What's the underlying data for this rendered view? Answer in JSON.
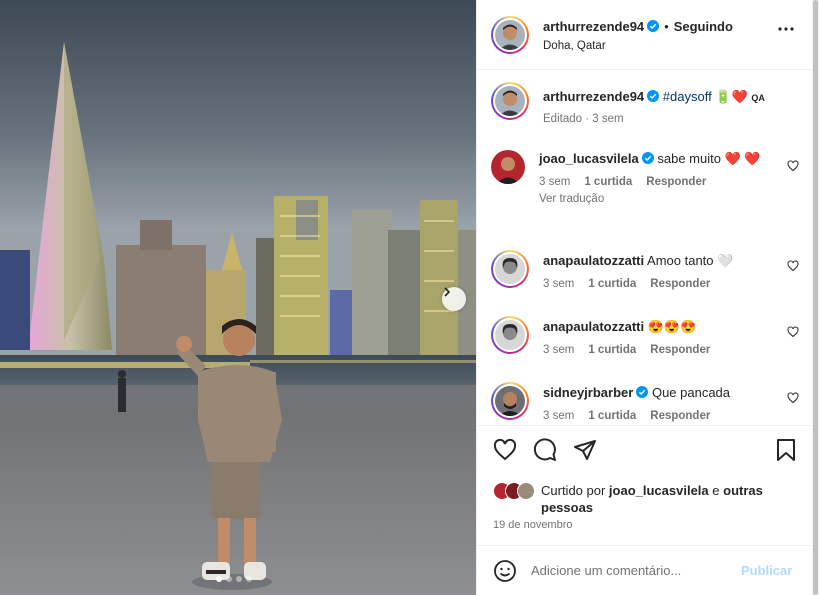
{
  "post": {
    "author": "arthurrezende94",
    "follow_sep": "•",
    "follow_status": "Seguindo",
    "location": "Doha, Qatar",
    "carousel_pages": 4,
    "carousel_active": 1
  },
  "caption": {
    "author": "arthurrezende94",
    "hashtag": "#daysoff",
    "emoji": "🔋❤️",
    "flag": "QA",
    "meta": "Editado · 3 sem"
  },
  "comments": [
    {
      "author": "joao_lucasvilela",
      "verified": true,
      "text": "sabe muito ❤️ ❤️",
      "time": "3 sem",
      "likes": "1 curtida",
      "reply": "Responder",
      "translate": "Ver tradução"
    },
    {
      "author": "anapaulatozzatti",
      "verified": false,
      "text": "Amoo tanto 🤍",
      "time": "3 sem",
      "likes": "1 curtida",
      "reply": "Responder"
    },
    {
      "author": "anapaulatozzatti",
      "verified": false,
      "text": "😍😍😍",
      "time": "3 sem",
      "likes": "1 curtida",
      "reply": "Responder"
    },
    {
      "author": "sidneyjrbarber",
      "verified": true,
      "text": "Que pancada",
      "time": "3 sem",
      "likes": "1 curtida",
      "reply": "Responder"
    }
  ],
  "likes": {
    "prefix": "Curtido por ",
    "user": "joao_lucasvilela",
    "middle": " e ",
    "others": "outras pessoas"
  },
  "date": "19 de novembro",
  "add_comment": {
    "placeholder": "Adicione um comentário...",
    "publish": "Publicar"
  },
  "colors": {
    "verified": "#0095f6",
    "link": "#00376b",
    "publish_disabled": "#b3dbff",
    "heart_red": "#ed4956"
  }
}
